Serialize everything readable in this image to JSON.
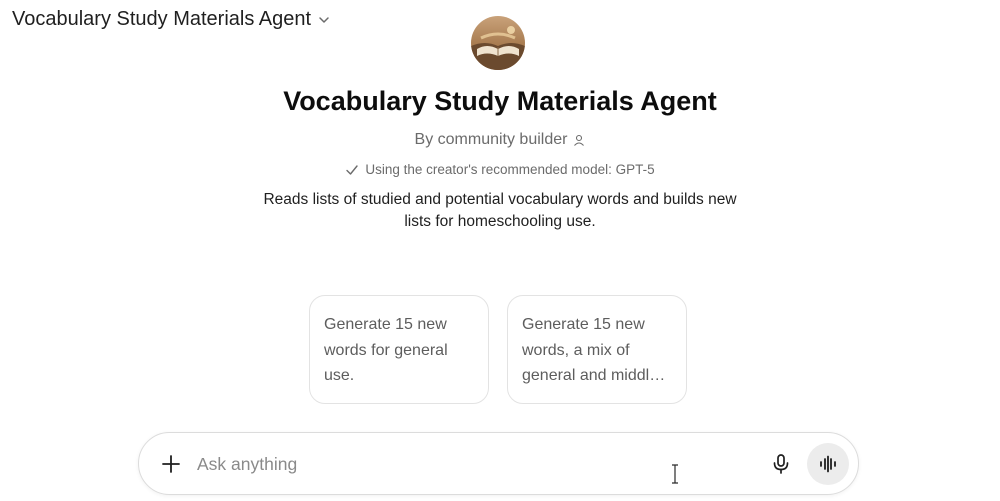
{
  "header": {
    "agent_name": "Vocabulary Study Materials Agent",
    "dropdown_icon": "chevron-down-icon"
  },
  "agent": {
    "avatar_icon": "agent-avatar",
    "title": "Vocabulary Study Materials Agent",
    "byline": "By community builder",
    "byline_icon": "person-icon",
    "model_note": "Using the creator's recommended model: GPT-5",
    "model_note_icon": "checkmark-icon",
    "description": "Reads lists of studied and potential vocabulary words and builds new lists for homeschooling use."
  },
  "suggestions": [
    {
      "label": "Generate 15 new words for general use."
    },
    {
      "label": "Generate 15 new words, a mix of general and middl…"
    }
  ],
  "composer": {
    "placeholder": "Ask anything",
    "value": "",
    "plus_icon": "plus-icon",
    "mic_icon": "microphone-icon",
    "voice_icon": "voice-mode-icon"
  },
  "colors": {
    "text_primary": "#0d0d0d",
    "text_secondary": "#6b6b6b",
    "border": "#e3e3e3",
    "voice_button_bg": "#ececec"
  }
}
